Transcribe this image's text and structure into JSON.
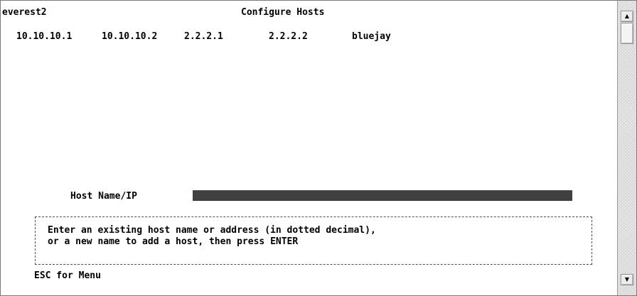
{
  "header": {
    "host": "everest2",
    "title": "Configure Hosts"
  },
  "hosts": [
    "10.10.10.1",
    "10.10.10.2",
    "2.2.2.1",
    "2.2.2.2",
    "bluejay"
  ],
  "form": {
    "label": "Host Name/IP",
    "value": ""
  },
  "help": {
    "line1": "Enter an existing host name or address (in dotted decimal),",
    "line2": "or a new name to add a host, then press ENTER"
  },
  "footer": {
    "hint": "ESC for Menu"
  },
  "scrollbar": {
    "up_glyph": "▲",
    "down_glyph": "▼"
  },
  "colors": {
    "field_bg": "#404040",
    "text": "#000000"
  }
}
